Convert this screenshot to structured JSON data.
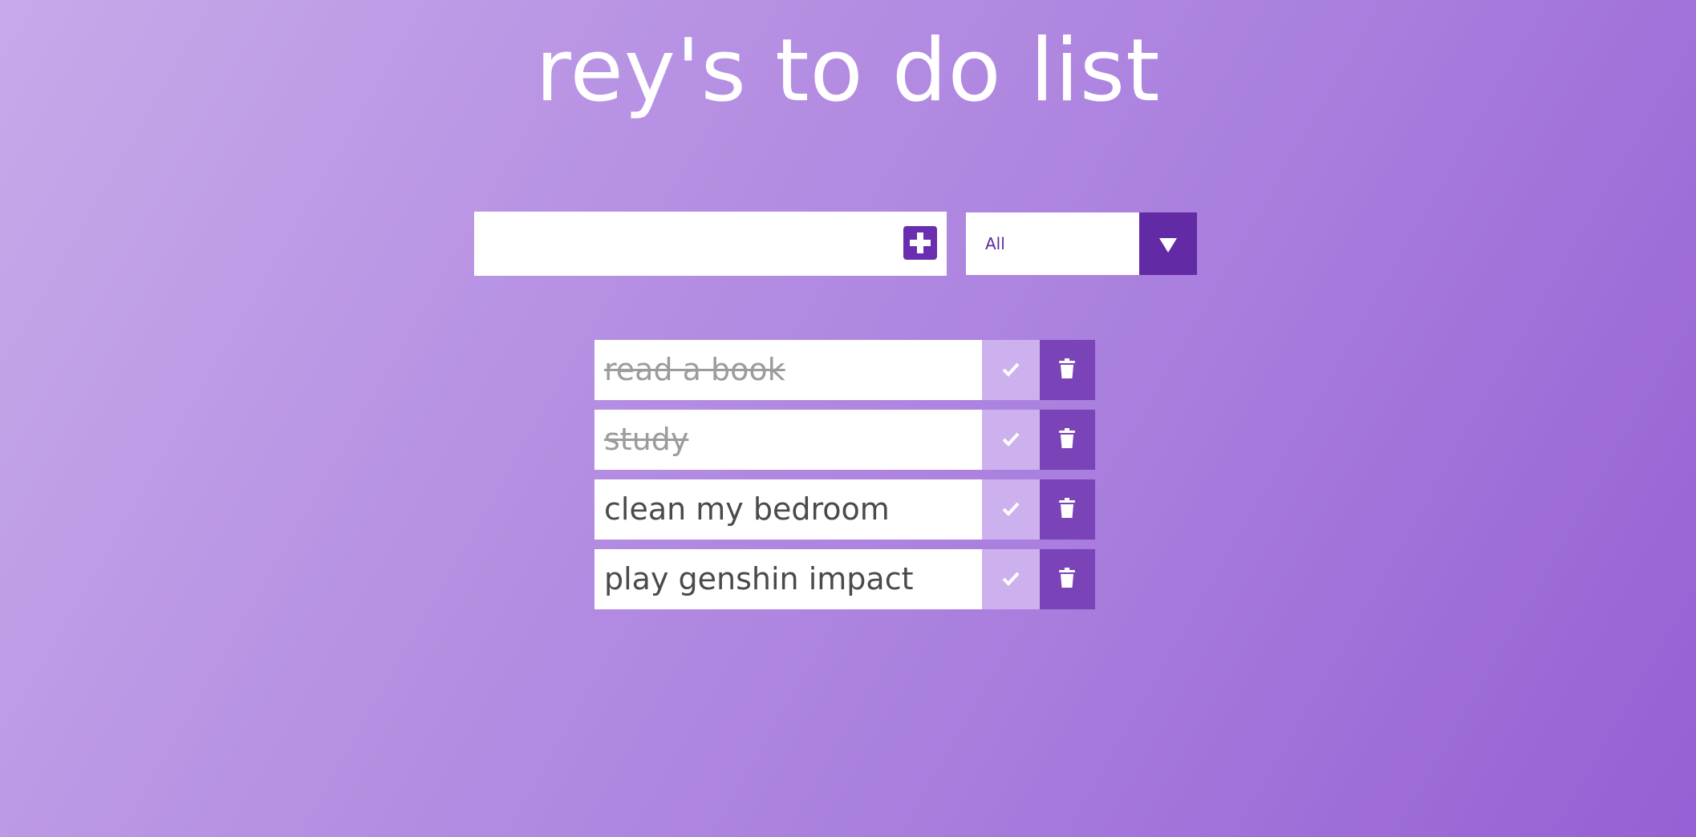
{
  "page": {
    "title": "rey's to do list"
  },
  "form": {
    "input_value": "",
    "add_icon": "plus-square-icon",
    "filter": {
      "selected": "All",
      "arrow_icon": "triangle-down-icon"
    }
  },
  "todos": [
    {
      "text": "read a book",
      "completed": true
    },
    {
      "text": "study",
      "completed": true
    },
    {
      "text": "clean my bedroom",
      "completed": false
    },
    {
      "text": "play genshin impact",
      "completed": false
    }
  ],
  "icons": {
    "complete": "check-icon",
    "delete": "trash-icon"
  },
  "colors": {
    "accent": "#6a2fb0",
    "check_button": "#cdb0ee",
    "trash_button": "#7a44b8",
    "completed_text": "#9c9c9c",
    "text": "#4a4a4a"
  }
}
